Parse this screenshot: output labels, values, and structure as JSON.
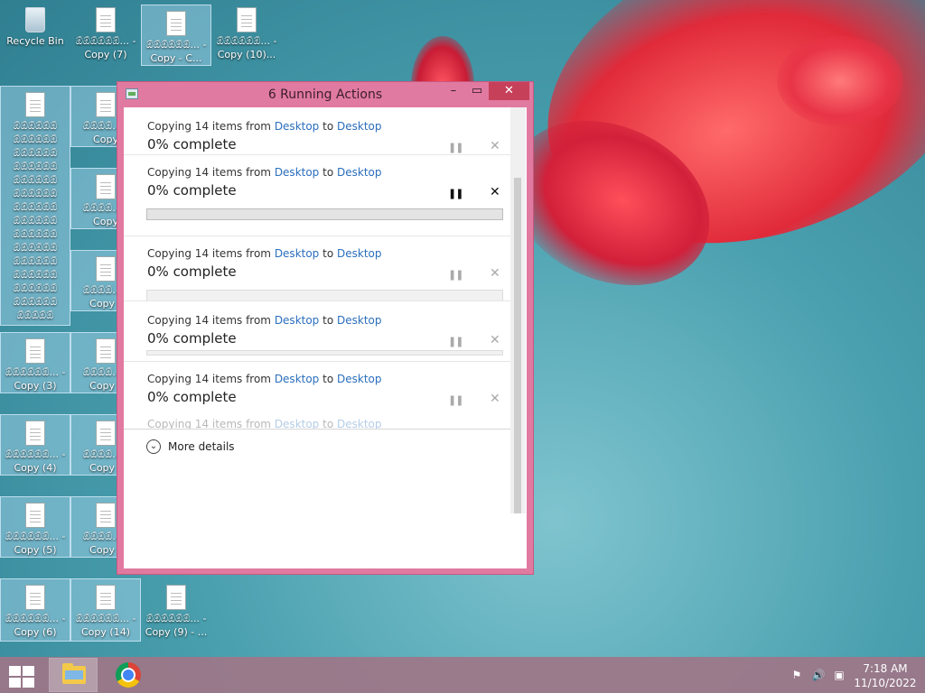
{
  "desktop": {
    "icons": [
      {
        "label": "Recycle Bin",
        "type": "recycle-bin"
      },
      {
        "label": "ඕඕඕඕඕඕ... - Copy (7)",
        "type": "doc"
      },
      {
        "label": "ඕඕඕඕඕඕ... - Copy - C...",
        "type": "doc"
      },
      {
        "label": "ඕඕඕඕඕඕ... - Copy (10)...",
        "type": "doc"
      },
      {
        "label": "ඕඕඕඕඕඕ ඕඕඕඕඕඕ ඕඕඕඕඕඕ ඕඕඕඕඕඕ ඕඕඕඕඕඕ ඕඕඕඕඕඕ ඕඕඕඕඕඕ ඕඕඕඕඕඕ ඕඕඕඕඕඕ ඕඕඕඕඕඕ ඕඕඕඕඕඕ ඕඕඕඕඕඕ ඕඕඕඕඕඕ ඕඕඕඕඕඕ ඕඕඕඕඕ",
        "type": "doc"
      },
      {
        "label": "ඕඕඕඕ... - Copy",
        "type": "doc"
      },
      {
        "label": "ඕඕඕඕ... - Copy",
        "type": "doc"
      },
      {
        "label": "ඕඕඕඕ... - Copy (",
        "type": "doc"
      },
      {
        "label": "ඕඕඕඕඕඕ... - Copy (3)",
        "type": "doc"
      },
      {
        "label": "ඕඕඕඕ... - Copy (",
        "type": "doc"
      },
      {
        "label": "ඕඕඕඕඕඕ... - Copy (4)",
        "type": "doc"
      },
      {
        "label": "ඕඕඕඕ... - Copy (",
        "type": "doc"
      },
      {
        "label": "ඕඕඕඕඕඕ... - Copy (5)",
        "type": "doc"
      },
      {
        "label": "ඕඕඕඕ... - Copy (",
        "type": "doc"
      },
      {
        "label": "ඕඕඕඕඕඕ... - Copy (6)",
        "type": "doc"
      },
      {
        "label": "ඕඕඕඕඕඕ... - Copy (14)",
        "type": "doc"
      },
      {
        "label": "ඕඕඕඕඕඕ... - Copy (9) - ...",
        "type": "doc"
      }
    ]
  },
  "dialog": {
    "title": "6 Running Actions",
    "items": [
      {
        "prefix": "Copying 14 items from ",
        "source": "Desktop",
        "mid": " to ",
        "dest": "Desktop",
        "status": "0% complete",
        "progress": 0
      },
      {
        "prefix": "Copying 14 items from ",
        "source": "Desktop",
        "mid": " to ",
        "dest": "Desktop",
        "status": "0% complete",
        "progress": 0
      },
      {
        "prefix": "Copying 14 items from ",
        "source": "Desktop",
        "mid": " to ",
        "dest": "Desktop",
        "status": "0% complete",
        "progress": 0
      },
      {
        "prefix": "Copying 14 items from ",
        "source": "Desktop",
        "mid": " to ",
        "dest": "Desktop",
        "status": "0% complete",
        "progress": 0
      },
      {
        "prefix": "Copying 14 items from ",
        "source": "Desktop",
        "mid": " to ",
        "dest": "Desktop",
        "status": "0% complete",
        "progress": 0
      },
      {
        "prefix": "Copying 14 items from ",
        "source": "Desktop",
        "mid": " to ",
        "dest": "Desktop"
      }
    ],
    "more_details": "More details",
    "pause_glyph": "❚❚",
    "close_glyph": "✕",
    "minimize_glyph": "–",
    "maximize_glyph": "▭",
    "window_close_glyph": "✕"
  },
  "taskbar": {
    "time": "7:18 AM",
    "date": "11/10/2022",
    "tray": [
      "flag-error-icon",
      "speaker-icon",
      "network-icon"
    ]
  },
  "colors": {
    "titlebar": "#e17aa0",
    "close_button": "#c7405a",
    "link": "#2a6ebd",
    "taskbar": "#9e7688"
  }
}
